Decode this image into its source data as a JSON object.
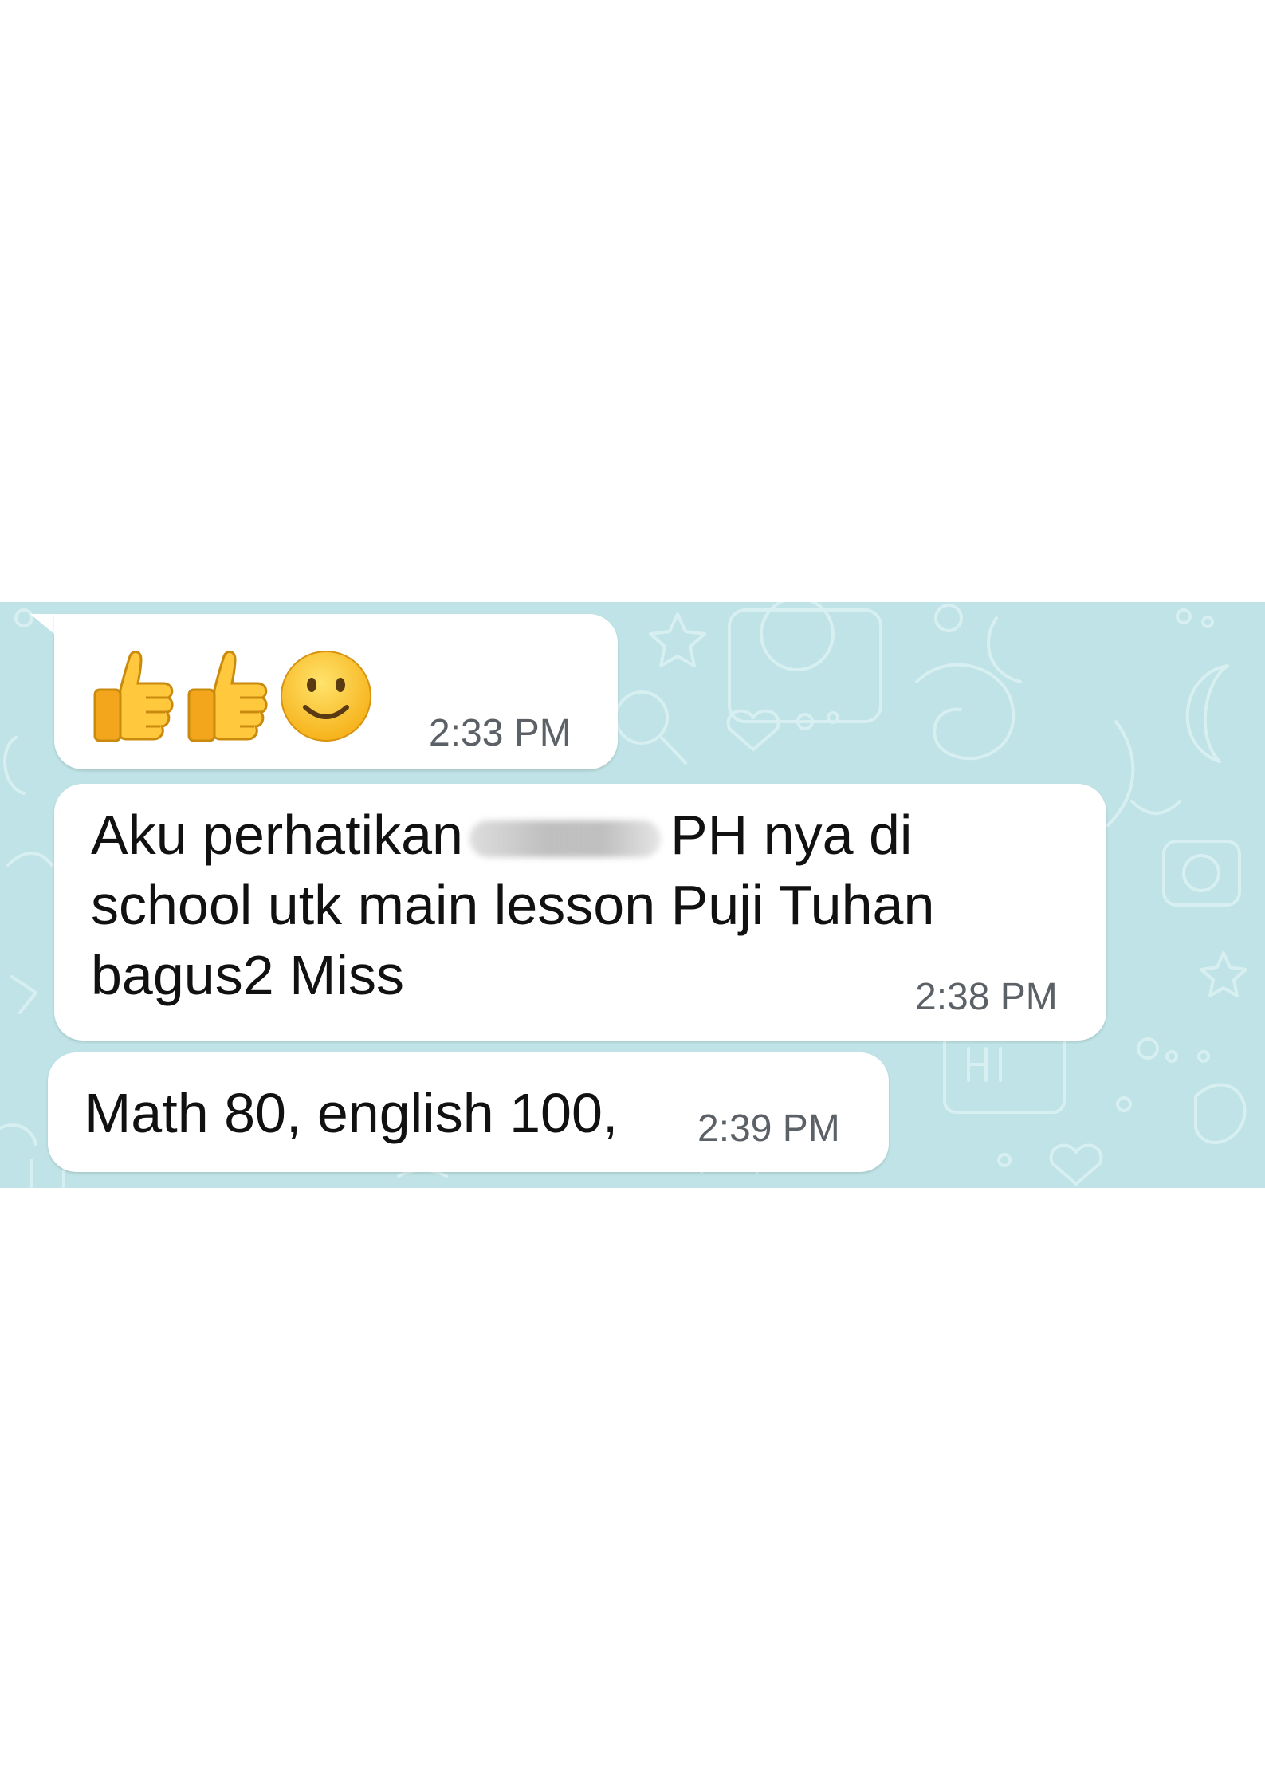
{
  "colors": {
    "wallpaper": "#bfe3e6",
    "wallpaper_doodle": "#d8eff1",
    "bubble": "#ffffff",
    "text": "#111111",
    "timestamp": "#5b6166"
  },
  "messages": [
    {
      "emojis": [
        "thumbs-up",
        "thumbs-up",
        "slightly-smiling-face"
      ],
      "time": "2:33 PM"
    },
    {
      "text_before_redaction": "Aku perhatikan",
      "text_after_redaction": "PH nya di school utk main lesson Puji Tuhan bagus2 Miss",
      "time": "2:38 PM"
    },
    {
      "text": "Math 80, english 100,",
      "time": "2:39 PM"
    }
  ]
}
